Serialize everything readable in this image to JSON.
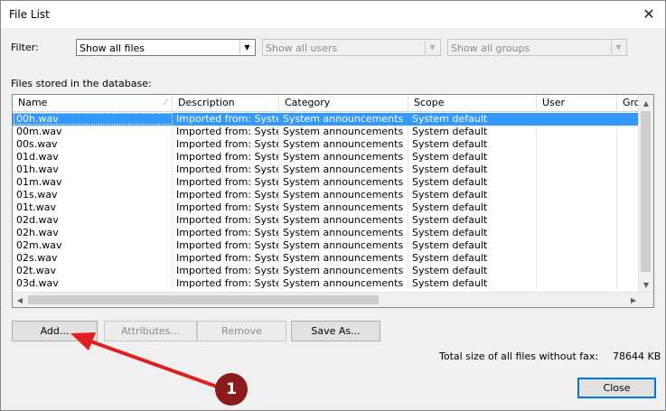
{
  "window": {
    "title": "File List"
  },
  "filter": {
    "label": "Filter:",
    "files": "Show all files",
    "users": "Show all users",
    "groups": "Show all groups"
  },
  "list_label": "Files stored in the database:",
  "columns": [
    "Name",
    "Description",
    "Category",
    "Scope",
    "User",
    "Grou"
  ],
  "rows": [
    [
      "00h.wav",
      "Imported from: Syste...",
      "System announcements",
      "System default"
    ],
    [
      "00m.wav",
      "Imported from: Syste...",
      "System announcements",
      "System default"
    ],
    [
      "00s.wav",
      "Imported from: Syste...",
      "System announcements",
      "System default"
    ],
    [
      "01d.wav",
      "Imported from: Syste...",
      "System announcements",
      "System default"
    ],
    [
      "01h.wav",
      "Imported from: Syste...",
      "System announcements",
      "System default"
    ],
    [
      "01m.wav",
      "Imported from: Syste...",
      "System announcements",
      "System default"
    ],
    [
      "01s.wav",
      "Imported from: Syste...",
      "System announcements",
      "System default"
    ],
    [
      "01t.wav",
      "Imported from: Syste...",
      "System announcements",
      "System default"
    ],
    [
      "02d.wav",
      "Imported from: Syste...",
      "System announcements",
      "System default"
    ],
    [
      "02h.wav",
      "Imported from: Syste...",
      "System announcements",
      "System default"
    ],
    [
      "02m.wav",
      "Imported from: Syste...",
      "System announcements",
      "System default"
    ],
    [
      "02s.wav",
      "Imported from: Syste...",
      "System announcements",
      "System default"
    ],
    [
      "02t.wav",
      "Imported from: Syste...",
      "System announcements",
      "System default"
    ],
    [
      "03d.wav",
      "Imported from: Syste...",
      "System announcements",
      "System default"
    ]
  ],
  "buttons": {
    "add": "Add...",
    "attributes": "Attributes...",
    "remove": "Remove",
    "save_as": "Save As...",
    "close": "Close"
  },
  "total": {
    "label": "Total size of all files without fax:",
    "value": "78644 KB"
  },
  "annotation": {
    "number": "1",
    "color": "#8b1a1a",
    "arrow_color": "#e02020"
  },
  "colors": {
    "selection": "#3399ff",
    "default_button_border": "#0078d7"
  }
}
